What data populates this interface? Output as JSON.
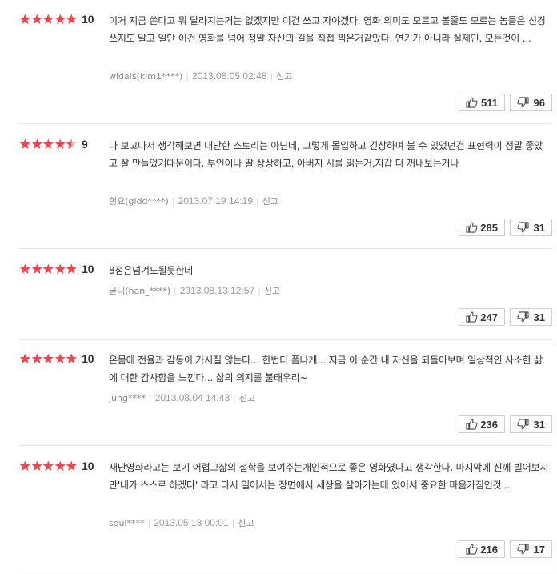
{
  "colors": {
    "star_on": "#f0434b",
    "star_off": "#cfcfcf",
    "text": "#333333",
    "meta": "#888888"
  },
  "reviews": [
    {
      "rating": 5,
      "score": "10",
      "text": "이거 지금 쓴다고 뭐 달라지는거는 없겠지만 이건 쓰고 자야겠다. 영화 의미도 모르고 볼줄도 모르는 놈들은 신경쓰지도 말고 일단 이건 영화를 넘어 정말 자신의 길을 직접 찍은거같았다. 연기가 아니라 실제인. 모든것이 ...",
      "user": "widals(kim1****)",
      "date": "2013.08.05 02:48",
      "report": "신고",
      "likes": "511",
      "dislikes": "96"
    },
    {
      "rating": 4.5,
      "score": "9",
      "text": "다 보고나서 생각해보면 대단한 스토리는 아닌데, 그렇게 몰입하고 긴장하며 볼 수 있었던건 표현력이 정말 좋았고 잘 만들었기때문이다. 부인이나 딸 상상하고, 아버지 시를 읽는거,지갑 다 꺼내보는거나",
      "user": "힝요(gldd****)",
      "date": "2013.07.19 14:19",
      "report": "신고",
      "likes": "285",
      "dislikes": "31"
    },
    {
      "rating": 5,
      "score": "10",
      "text": "8점은넘겨도될듯한데",
      "user": "굳니(han_****)",
      "date": "2013.08.13 12:57",
      "report": "신고",
      "likes": "247",
      "dislikes": "31"
    },
    {
      "rating": 5,
      "score": "10",
      "text": "온몸에 전율과 감동이 가시질 않는다... 한번더 폼나게... 지금 이 순간 내 자신을 되돌아보며 일상적인 사소한 삶에 대한 감사함을 느낀다... 삶의 의지를 불태우리~",
      "user": "jung****",
      "date": "2013.08.04 14:43",
      "report": "신고",
      "likes": "236",
      "dislikes": "31"
    },
    {
      "rating": 5,
      "score": "10",
      "text": "재난영화라고는 보기 어렵고삶의 철학을 보여주는개인적으로 좋은 영화였다고 생각한다. 마지막에 신께 빌어보지만'내가 스스로 하겠다' 라고 다시 일어서는 장면에서 세상을 살아가는데 있어서 중요한 마음가짐인것...",
      "user": "soul****",
      "date": "2013.05.13 00:01",
      "report": "신고",
      "likes": "216",
      "dislikes": "17"
    }
  ]
}
